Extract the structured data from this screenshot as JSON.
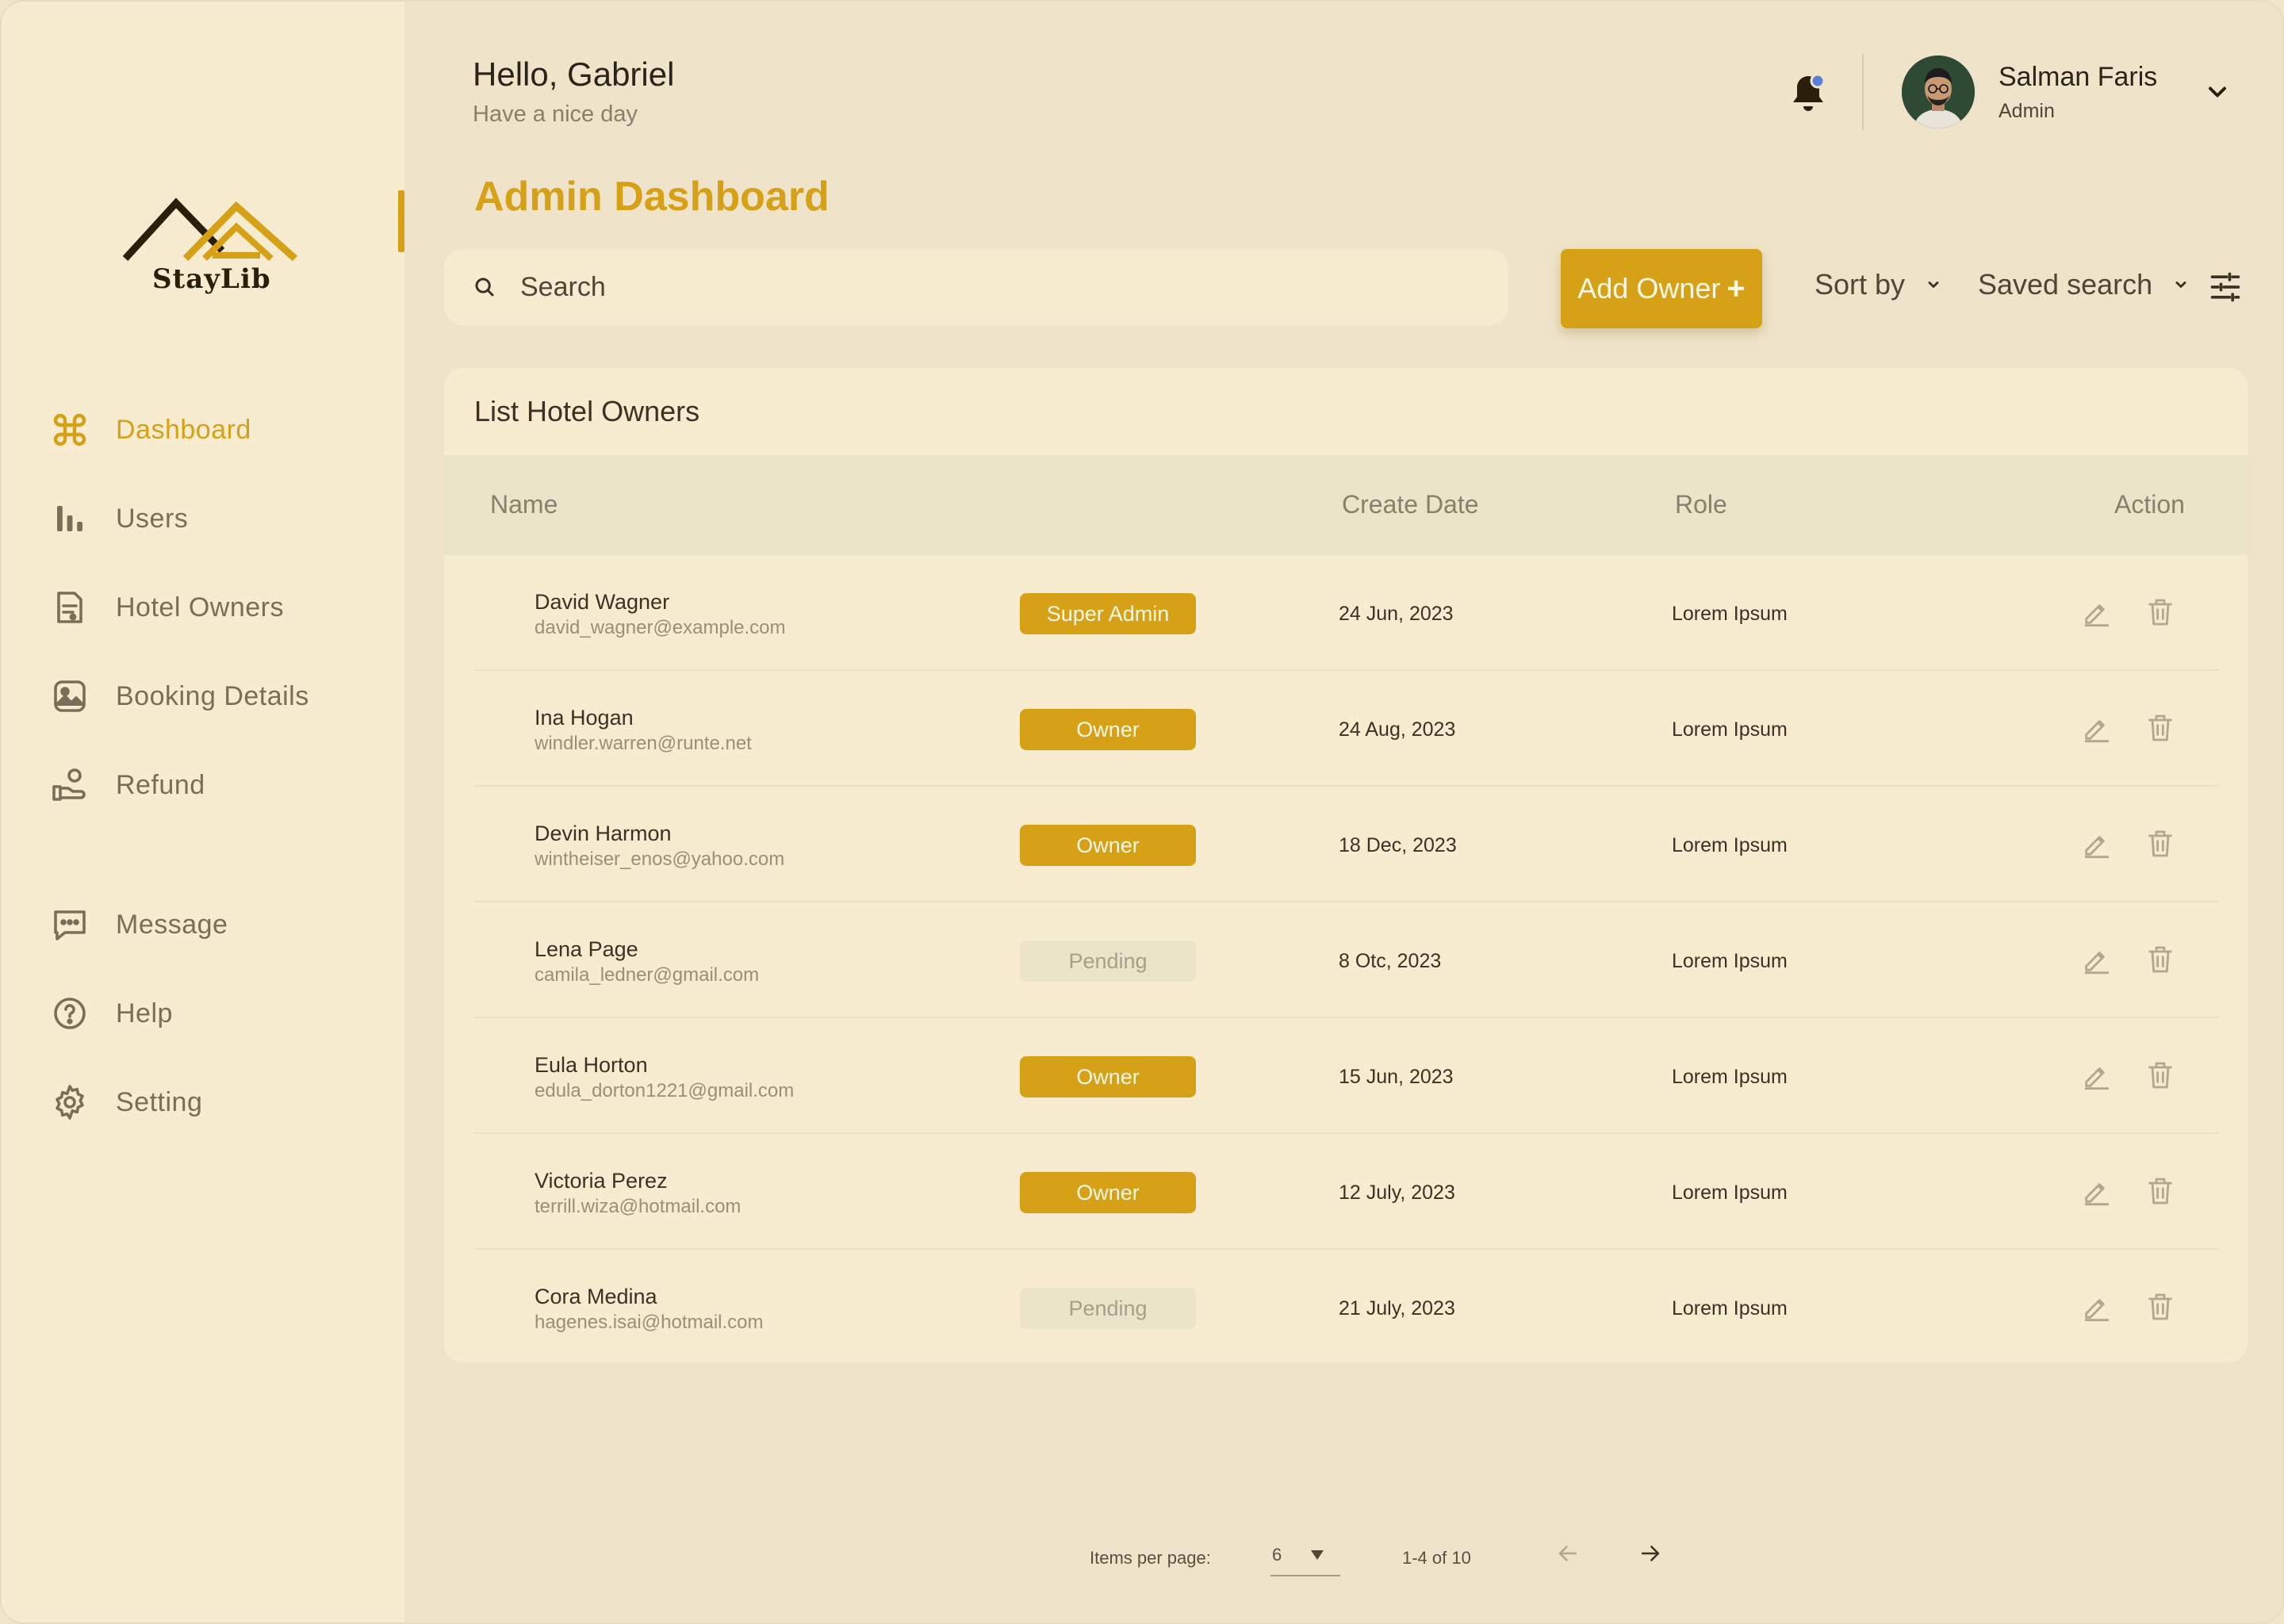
{
  "brand": {
    "name": "StayLib"
  },
  "colors": {
    "accent": "#d6a117",
    "sidebar_bg": "#f7ebd0",
    "page_bg": "#efe4c9",
    "pending": "#ece4c8"
  },
  "sidebar": {
    "items": [
      {
        "label": "Dashboard",
        "icon": "command-icon",
        "active": true
      },
      {
        "label": "Users",
        "icon": "bar-chart-icon"
      },
      {
        "label": "Hotel Owners",
        "icon": "document-icon"
      },
      {
        "label": "Booking Details",
        "icon": "image-icon"
      },
      {
        "label": "Refund",
        "icon": "hand-coin-icon"
      },
      {
        "label": "Message",
        "icon": "message-icon"
      },
      {
        "label": "Help",
        "icon": "help-icon"
      },
      {
        "label": "Setting",
        "icon": "gear-icon"
      }
    ]
  },
  "header": {
    "greeting": "Hello, Gabriel",
    "subtitle": "Have a nice day",
    "user_name": "Salman Faris",
    "user_role": "Admin"
  },
  "page_title": "Admin Dashboard",
  "toolbar": {
    "search_placeholder": "Search",
    "add_label": "Add Owner",
    "add_symbol": "+",
    "sort_label": "Sort by",
    "saved_label": "Saved search"
  },
  "table": {
    "title": "List Hotel Owners",
    "columns": [
      "Name",
      "Create Date",
      "Role",
      "Action"
    ],
    "rows": [
      {
        "name": "David Wagner",
        "email": "david_wagner@example.com",
        "badge": "Super Admin",
        "status": "gold",
        "date": "24 Jun, 2023",
        "role": "Lorem Ipsum"
      },
      {
        "name": "Ina Hogan",
        "email": "windler.warren@runte.net",
        "badge": "Owner",
        "status": "gold",
        "date": "24 Aug, 2023",
        "role": "Lorem Ipsum"
      },
      {
        "name": "Devin Harmon",
        "email": "wintheiser_enos@yahoo.com",
        "badge": "Owner",
        "status": "gold",
        "date": "18 Dec, 2023",
        "role": "Lorem Ipsum"
      },
      {
        "name": "Lena Page",
        "email": "camila_ledner@gmail.com",
        "badge": "Pending",
        "status": "gray",
        "date": "8 Otc, 2023",
        "role": "Lorem Ipsum"
      },
      {
        "name": "Eula Horton",
        "email": "edula_dorton1221@gmail.com",
        "badge": "Owner",
        "status": "gold",
        "date": "15 Jun, 2023",
        "role": "Lorem Ipsum"
      },
      {
        "name": "Victoria Perez",
        "email": "terrill.wiza@hotmail.com",
        "badge": "Owner",
        "status": "gold",
        "date": "12 July, 2023",
        "role": "Lorem Ipsum"
      },
      {
        "name": "Cora Medina",
        "email": "hagenes.isai@hotmail.com",
        "badge": "Pending",
        "status": "gray",
        "date": "21 July, 2023",
        "role": "Lorem Ipsum"
      }
    ]
  },
  "pagination": {
    "label": "Items per page:",
    "per_page": "6",
    "range": "1-4 of 10"
  }
}
